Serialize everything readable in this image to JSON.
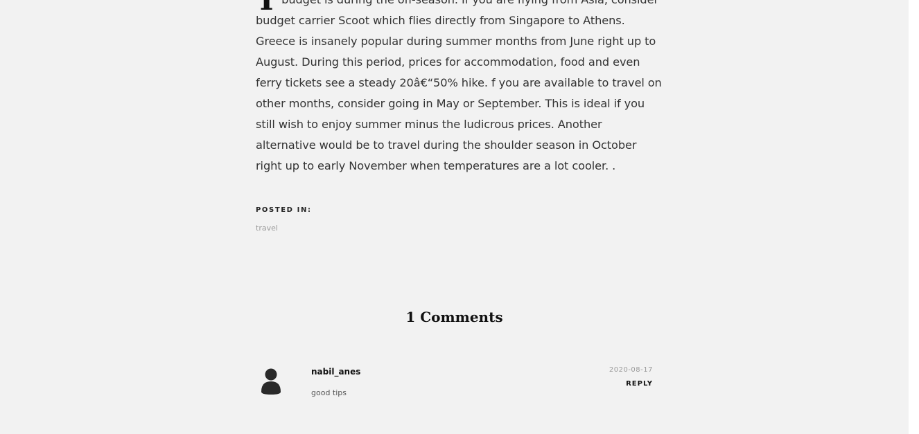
{
  "article": {
    "dropcap": "T",
    "lines": [
      "budget is during the off-season. If you are flying from Asia, consider",
      "budget carrier Scoot which flies directly from Singapore to Athens.",
      "Greece is insanely popular during summer months from June right up to",
      "August. During this period, prices for accommodation, food and even",
      "ferry tickets see a steady 20â€“50% hike. f you are available to travel on",
      "other months, consider going in May or September. This is ideal if you",
      "still wish to enjoy summer minus the ludicrous prices. Another",
      "alternative would be to travel during the shoulder season in October",
      "right up to early November when temperatures are a lot cooler. ."
    ]
  },
  "posted_in": {
    "label": "POSTED IN:",
    "tag": "travel"
  },
  "comments": {
    "title": "1 Comments",
    "items": [
      {
        "author": "nabil_anes",
        "date": "2020-08-17",
        "reply_label": "REPLY",
        "text": "good tips",
        "avatar_icon": "user-avatar-icon"
      }
    ]
  },
  "colors": {
    "background": "#f2f2f2",
    "text": "#333333",
    "muted": "#9a9a9a"
  }
}
